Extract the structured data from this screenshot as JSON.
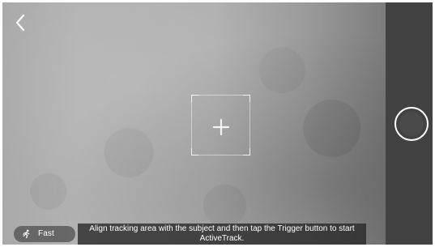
{
  "navigation": {
    "back_icon": "chevron-left-icon"
  },
  "viewfinder": {
    "tracking_area_icon": "crosshair-icon"
  },
  "status": {
    "speed_mode_label": "Fast",
    "speed_mode_icon": "running-person-icon",
    "instruction_text": "Align tracking area with the subject and then tap the Trigger button to start ActiveTrack."
  },
  "controls": {
    "trigger_icon": "record-circle-icon"
  },
  "colors": {
    "side_panel": "#424242",
    "trigger_border": "#ffffff",
    "instruction_background": "#262626"
  }
}
